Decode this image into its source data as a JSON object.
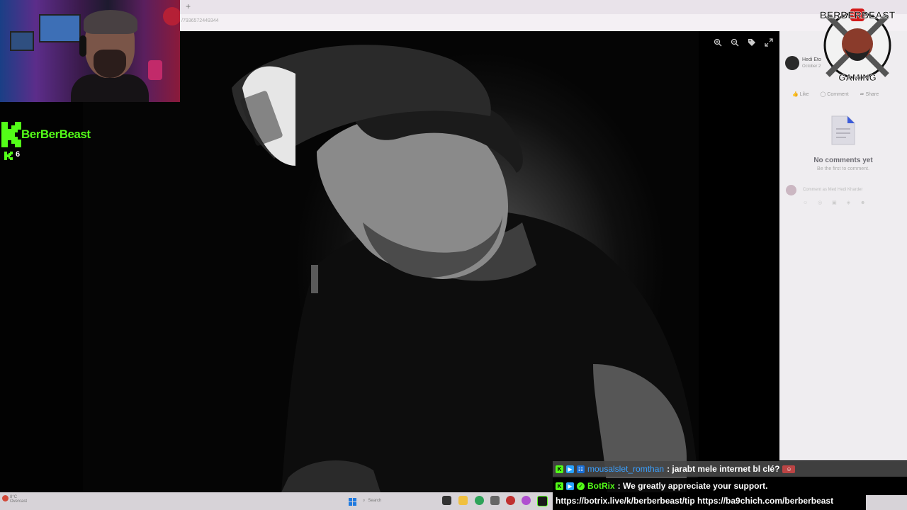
{
  "browser": {
    "new_tab_glyph": "+",
    "url": "/7936572449344"
  },
  "stream": {
    "channel_name": "BerBerBeast",
    "viewer_count": "6",
    "brand_colors": {
      "kick_green": "#53fc18",
      "chat_blue": "#3aa0ff"
    }
  },
  "brand_logo": {
    "text_top": "BERBERBEAST",
    "text_bottom": "GAMING"
  },
  "photo_viewer": {
    "tools": [
      "zoom-in-icon",
      "zoom-out-icon",
      "tag-icon",
      "expand-icon"
    ]
  },
  "post_panel": {
    "author": "Hedi Eto",
    "date": "October 2",
    "actions": {
      "like": "Like",
      "comment": "Comment",
      "share": "Share"
    },
    "no_comments": "No comments yet",
    "be_first": "Be the first to comment.",
    "comment_placeholder": "Comment as Med Hedi Kharder"
  },
  "chat": {
    "messages": [
      {
        "user": "mousalslet_romthan",
        "text": ": jarabt mele internet bl clé?"
      },
      {
        "user": "BotRix",
        "text": ": We greatly appreciate your support."
      },
      {
        "user": "",
        "text": "https://botrix.live/k/berberbeast/tip https://ba9chich.com/berberbeast"
      }
    ]
  },
  "taskbar": {
    "weather": "8°C",
    "weather_sub": "Overcast",
    "search_placeholder": "Search"
  }
}
